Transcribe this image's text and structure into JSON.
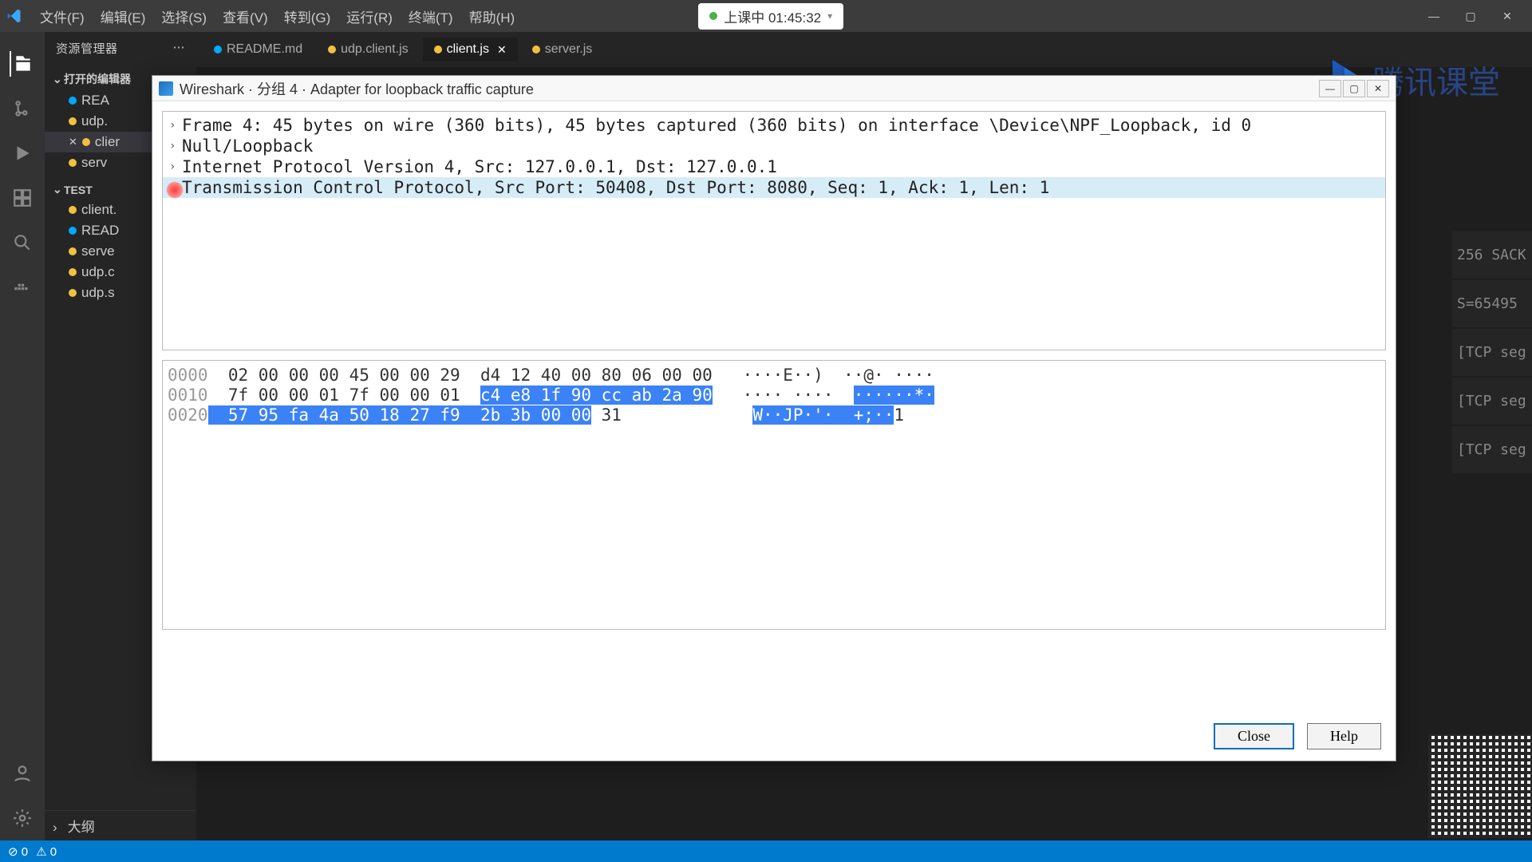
{
  "menu": {
    "items": [
      "文件(F)",
      "编辑(E)",
      "选择(S)",
      "查看(V)",
      "转到(G)",
      "运行(R)",
      "终端(T)",
      "帮助(H)"
    ]
  },
  "status_pill": {
    "label": "上课中 01:45:32"
  },
  "sidebar": {
    "title": "资源管理器",
    "open_editors_label": "打开的编辑器",
    "open_editors": [
      {
        "name": "REA",
        "dot": "blue"
      },
      {
        "name": "udp.",
        "dot": "yellow"
      },
      {
        "name": "clier",
        "dot": "yellow",
        "closeable": true,
        "selected": true
      },
      {
        "name": "serv",
        "dot": "yellow"
      }
    ],
    "folder_label": "TEST",
    "files": [
      {
        "name": "client.",
        "dot": "yellow"
      },
      {
        "name": "READ",
        "dot": "blue"
      },
      {
        "name": "serve",
        "dot": "yellow"
      },
      {
        "name": "udp.c",
        "dot": "yellow"
      },
      {
        "name": "udp.s",
        "dot": "yellow"
      }
    ],
    "outline_label": "大纲"
  },
  "tabs": [
    {
      "label": "README.md",
      "dot": "blue"
    },
    {
      "label": "udp.client.js",
      "dot": "yellow"
    },
    {
      "label": "client.js",
      "dot": "yellow",
      "active": true,
      "closeable": true
    },
    {
      "label": "server.js",
      "dot": "yellow"
    }
  ],
  "dialog": {
    "title": "Wireshark · 分组 4 · Adapter for loopback traffic capture",
    "tree": [
      "Frame 4: 45 bytes on wire (360 bits), 45 bytes captured (360 bits) on interface \\Device\\NPF_Loopback, id 0",
      "Null/Loopback",
      "Internet Protocol Version 4, Src: 127.0.0.1, Dst: 127.0.0.1",
      "Transmission Control Protocol, Src Port: 50408, Dst Port: 8080, Seq: 1, Ack: 1, Len: 1"
    ],
    "hex": {
      "row0": {
        "offset": "0000",
        "plain1": "  02 00 00 00 45 00 00 29  d4 12 40 00 80 06 00 00",
        "ascii": "   ····E··)  ··@· ····"
      },
      "row1": {
        "offset": "0010",
        "plain1": "  7f 00 00 01 7f 00 00 01  ",
        "hl1": "c4 e8 1f 90 cc ab 2a 90",
        "ascii_plain": "   ···· ····  ",
        "ascii_hl": "······*·"
      },
      "row2": {
        "offset": "0020",
        "hl1": "  57 95 fa 4a 50 18 27 f9  2b 3b 00 00",
        "plain1": " 31",
        "ascii_pad": "             ",
        "ascii_hl": "W··JP·'·  +;··",
        "ascii_plain2": "1"
      }
    },
    "close_btn": "Close",
    "help_btn": "Help"
  },
  "right_fragments": [
    "256 SACK",
    "S=65495",
    "[TCP seg",
    "[TCP seg",
    "[TCP seg"
  ],
  "status_bar": {
    "errors": "⊘ 0",
    "warnings": "⚠ 0"
  },
  "brand_text": "腾讯课堂"
}
